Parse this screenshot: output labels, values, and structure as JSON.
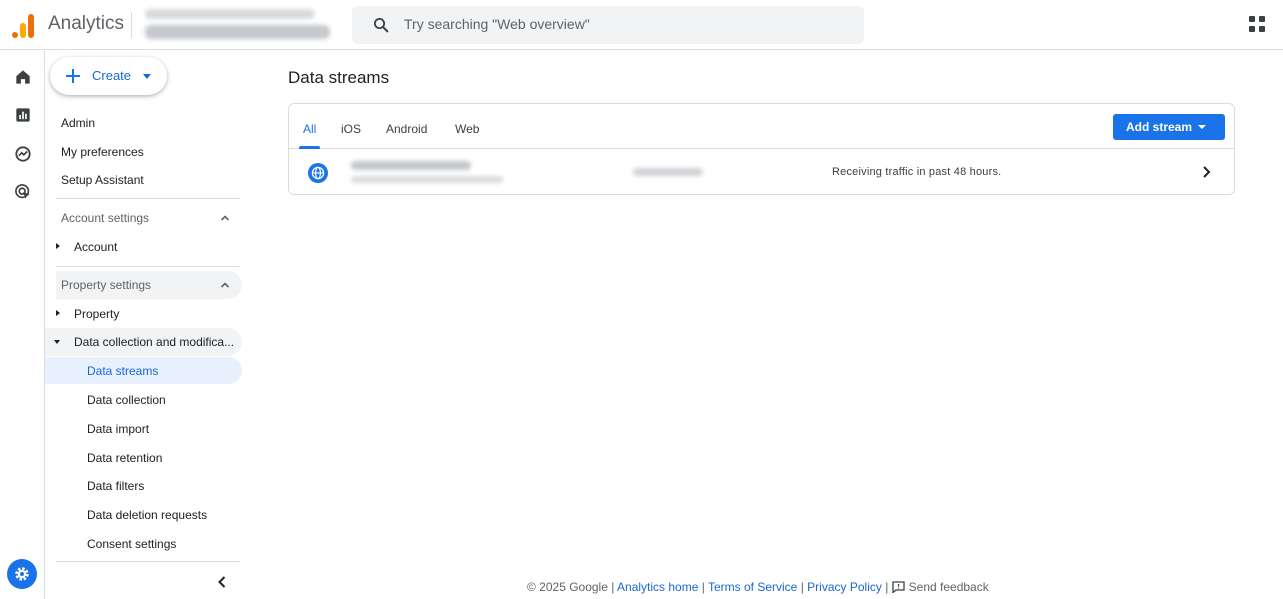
{
  "header": {
    "app_name": "Analytics",
    "search_placeholder": "Try searching \"Web overview\""
  },
  "rail": {
    "icons": [
      "home-icon",
      "reports-icon",
      "explore-icon",
      "advertising-icon",
      "admin-gear-icon"
    ]
  },
  "sidebar": {
    "create_label": "Create",
    "top_items": [
      "Admin",
      "My preferences",
      "Setup Assistant"
    ],
    "account_section": "Account settings",
    "account_item": "Account",
    "property_section": "Property settings",
    "property_item": "Property",
    "data_collection_item": "Data collection and modifica...",
    "sub_items": [
      "Data streams",
      "Data collection",
      "Data import",
      "Data retention",
      "Data filters",
      "Data deletion requests",
      "Consent settings"
    ],
    "selected_sub_item": "Data streams"
  },
  "main": {
    "title": "Data streams",
    "tabs": [
      "All",
      "iOS",
      "Android",
      "Web"
    ],
    "active_tab": "All",
    "add_stream_label": "Add stream",
    "stream_row": {
      "status": "Receiving traffic in past 48 hours."
    }
  },
  "footer": {
    "copyright": "© 2025 Google |",
    "links": [
      "Analytics home",
      "Terms of Service",
      "Privacy Policy"
    ],
    "separator": "|",
    "feedback": "Send feedback"
  },
  "colors": {
    "accent": "#1a73e8",
    "selected_bg": "#e8f0fe",
    "logo_orange": "#e8710a",
    "logo_yellow": "#f9ab00"
  }
}
